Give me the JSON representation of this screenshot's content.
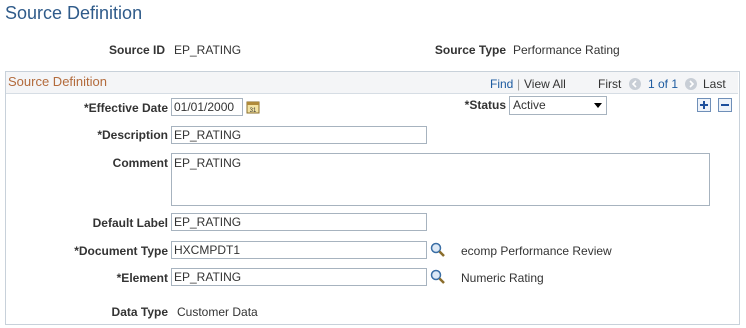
{
  "page": {
    "title": "Source Definition"
  },
  "header": {
    "source_id_label": "Source ID",
    "source_id_value": "EP_RATING",
    "source_type_label": "Source Type",
    "source_type_value": "Performance Rating"
  },
  "panel": {
    "title": "Source Definition",
    "nav": {
      "find": "Find",
      "separator": "|",
      "view_all": "View All",
      "first": "First",
      "page_info": "1 of 1",
      "last": "Last"
    }
  },
  "form": {
    "effective_date_label": "*Effective Date",
    "effective_date_value": "01/01/2000",
    "status_label": "*Status",
    "status_value": "Active",
    "description_label": "*Description",
    "description_value": "EP_RATING",
    "comment_label": "Comment",
    "comment_value": "EP_RATING",
    "default_label_label": "Default Label",
    "default_label_value": "EP_RATING",
    "document_type_label": "*Document Type",
    "document_type_value": "HXCMPDT1",
    "document_type_desc": "ecomp Performance Review",
    "element_label": "*Element",
    "element_value": "EP_RATING",
    "element_desc": "Numeric Rating",
    "data_type_label": "Data Type",
    "data_type_value": "Customer Data"
  },
  "icons": {
    "calendar": "calendar-icon",
    "lookup": "magnifier-icon",
    "add": "plus-icon",
    "delete": "minus-icon",
    "prev": "chevron-left-icon",
    "next": "chevron-right-icon"
  },
  "colors": {
    "title": "#2f5b8a",
    "panel_title": "#b36b3c",
    "link": "#1d5ba0",
    "border": "#a7b3bf"
  }
}
